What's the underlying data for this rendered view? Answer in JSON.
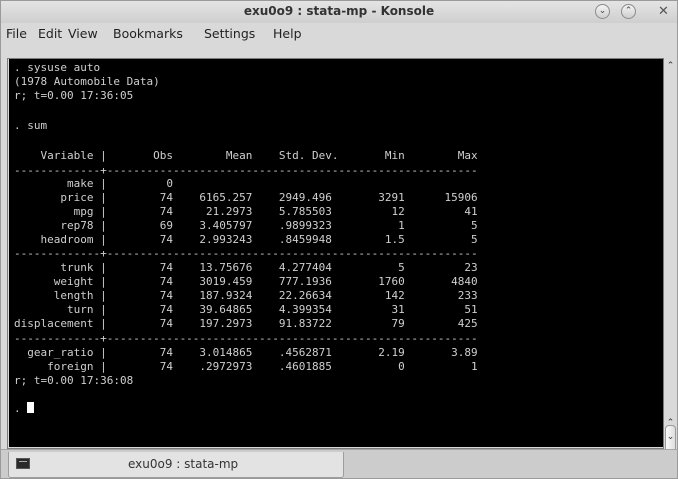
{
  "window": {
    "title": "exu0o9 : stata-mp - Konsole",
    "minimize_glyph": "⌄",
    "maximize_glyph": "⌃",
    "close_glyph": "✕"
  },
  "menubar": [
    "File",
    "Edit",
    "View",
    "Bookmarks",
    "Settings",
    "Help"
  ],
  "terminal": {
    "lines": [
      ". sysuse auto",
      "(1978 Automobile Data)",
      "r; t=0.00 17:36:05",
      "",
      ". sum",
      "",
      "    Variable |       Obs        Mean    Std. Dev.       Min        Max",
      "-------------+--------------------------------------------------------",
      "        make |         0",
      "       price |        74    6165.257    2949.496       3291      15906",
      "         mpg |        74     21.2973    5.785503         12         41",
      "       rep78 |        69    3.405797    .9899323          1          5",
      "    headroom |        74    2.993243    .8459948        1.5          5",
      "-------------+--------------------------------------------------------",
      "       trunk |        74    13.75676    4.277404          5         23",
      "      weight |        74    3019.459    777.1936       1760       4840",
      "      length |        74    187.9324    22.26634        142        233",
      "        turn |        74    39.64865    4.399354         31         51",
      "displacement |        74    197.2973    91.83722         79        425",
      "-------------+--------------------------------------------------------",
      "  gear_ratio |        74    3.014865    .4562871       2.19       3.89",
      "     foreign |        74    .2972973    .4601885          0          1",
      "r; t=0.00 17:36:08",
      "",
      ". "
    ]
  },
  "scrollbar": {
    "up_glyph": "⌃",
    "down_glyph": "⌄"
  },
  "tab": {
    "label": "exu0o9 : stata-mp"
  }
}
